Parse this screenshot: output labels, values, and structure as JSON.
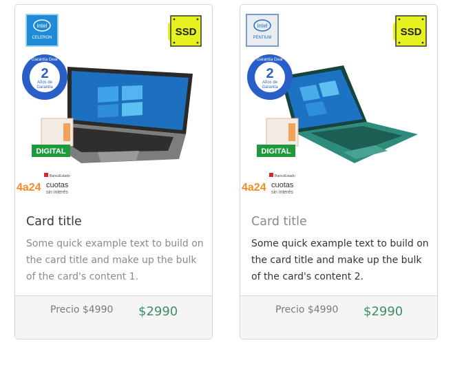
{
  "cards": [
    {
      "title": "Card title",
      "text": "Some quick example text to build on the card title and make up the bulk of the card's content 1.",
      "old_price": "Precio $4990",
      "new_price": "$2990",
      "processor_badge": {
        "brand": "intel",
        "model": "CELERON"
      },
      "storage_badge": "SSD",
      "warranty": {
        "top": "Garantía Gear",
        "number": "2",
        "line1": "Años de",
        "line2": "Garantía"
      },
      "digital_label": "DIGITAL",
      "installments": {
        "range": "4a24",
        "word": "cuotas",
        "sub": "sin interés",
        "bank": "BancoEstado"
      },
      "laptop_color": "gray"
    },
    {
      "title": "Card title",
      "text": "Some quick example text to build on the card title and make up the bulk of the card's content 2.",
      "old_price": "Precio $4990",
      "new_price": "$2990",
      "processor_badge": {
        "brand": "intel",
        "model": "PENTIUM"
      },
      "storage_badge": "SSD",
      "warranty": {
        "top": "Garantía Gear",
        "number": "2",
        "line1": "Años de",
        "line2": "Garantía"
      },
      "digital_label": "DIGITAL",
      "installments": {
        "range": "4a24",
        "word": "cuotas",
        "sub": "sin interés",
        "bank": "BancoEstado"
      },
      "laptop_color": "green"
    }
  ],
  "colors": {
    "price_green": "#3f8f66",
    "ssd_yellow": "#e6f21f",
    "digital_green": "#1e9a3c",
    "warranty_blue": "#2a5fc9",
    "intel_blue": "#1f8ad6"
  }
}
